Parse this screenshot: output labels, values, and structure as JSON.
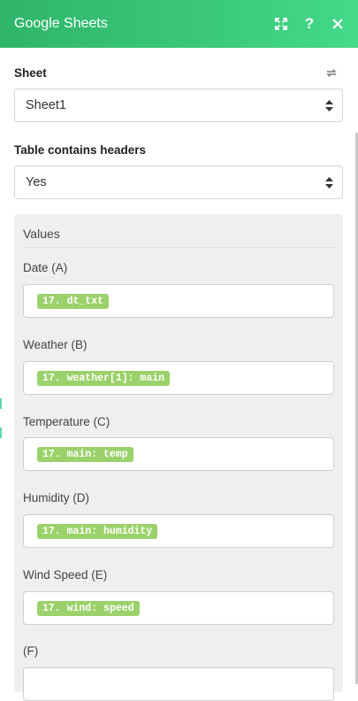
{
  "header": {
    "title": "Google Sheets"
  },
  "sheet": {
    "label": "Sheet",
    "value": "Sheet1"
  },
  "headers_field": {
    "label": "Table contains headers",
    "value": "Yes"
  },
  "values_panel": {
    "title": "Values",
    "fields": [
      {
        "label": "Date (A)",
        "pill": "17. dt_txt"
      },
      {
        "label": "Weather (B)",
        "pill": "17. weather[1]: main"
      },
      {
        "label": "Temperature (C)",
        "pill": "17. main: temp"
      },
      {
        "label": "Humidity (D)",
        "pill": "17. main: humidity"
      },
      {
        "label": "Wind Speed (E)",
        "pill": "17. wind: speed"
      },
      {
        "label": "(F)",
        "pill": ""
      }
    ]
  },
  "colors": {
    "header_start": "#2fb56a",
    "header_end": "#45d98a",
    "pill_bg": "#9bd16a"
  }
}
